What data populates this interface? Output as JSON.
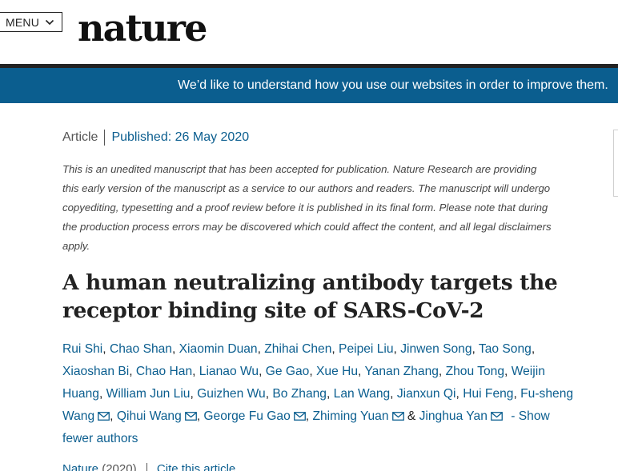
{
  "header": {
    "menu_label": "MENU",
    "logo_text": "nature"
  },
  "banner": {
    "text": "We’d like to understand how you use our websites in order to improve them."
  },
  "article": {
    "type": "Article",
    "published": "Published: 26 May 2020",
    "notice": "This is an unedited manuscript that has been accepted for publication. Nature Research are providing this early version of the manuscript as a service to our authors and readers. The manuscript will undergo copyediting, typesetting and a proof review before it is published in its final form. Please note that during the production process errors may be discovered which could affect the content, and all legal disclaimers apply.",
    "title": "A human neutralizing antibody targets the receptor binding site of SARS-CoV-2",
    "authors": [
      "Rui Shi",
      "Chao Shan",
      "Xiaomin Duan",
      "Zhihai Chen",
      "Peipei Liu",
      "Jinwen Song",
      "Tao Song",
      "Xiaoshan Bi",
      "Chao Han",
      "Lianao Wu",
      "Ge Gao",
      "Xue Hu",
      "Yanan Zhang",
      "Zhou Tong",
      "Weijin Huang",
      "William Jun Liu",
      "Guizhen Wu",
      "Bo Zhang",
      "Lan Wang",
      "Jianxun Qi",
      "Hui Feng",
      "Fu-sheng Wang",
      "Qihui Wang",
      "George Fu Gao",
      "Zhiming Yuan",
      "Jinghua Yan"
    ],
    "corresponding_authors": [
      "Fu-sheng Wang",
      "Qihui Wang",
      "George Fu Gao",
      "Zhiming Yuan",
      "Jinghua Yan"
    ],
    "and_symbol": "&",
    "show_fewer_label": "- Show fewer authors",
    "journal": "Nature",
    "year": "(2020)",
    "cite_label": "Cite this article"
  },
  "colors": {
    "link": "#0b5e8f",
    "banner_bg": "#0b5e8f"
  }
}
